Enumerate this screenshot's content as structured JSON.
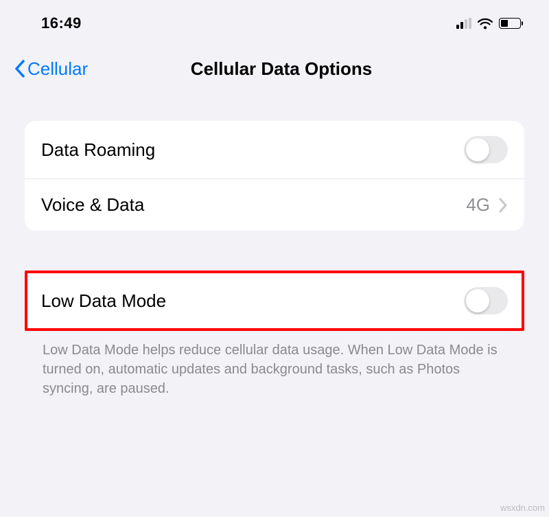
{
  "status": {
    "time": "16:49"
  },
  "nav": {
    "back_label": "Cellular",
    "title": "Cellular Data Options"
  },
  "group1": {
    "data_roaming": {
      "label": "Data Roaming",
      "on": false
    },
    "voice_data": {
      "label": "Voice & Data",
      "value": "4G"
    }
  },
  "group2": {
    "low_data_mode": {
      "label": "Low Data Mode",
      "on": false
    },
    "footer": "Low Data Mode helps reduce cellular data usage. When Low Data Mode is turned on, automatic updates and background tasks, such as Photos syncing, are paused."
  },
  "watermark": "wsxdn.com"
}
